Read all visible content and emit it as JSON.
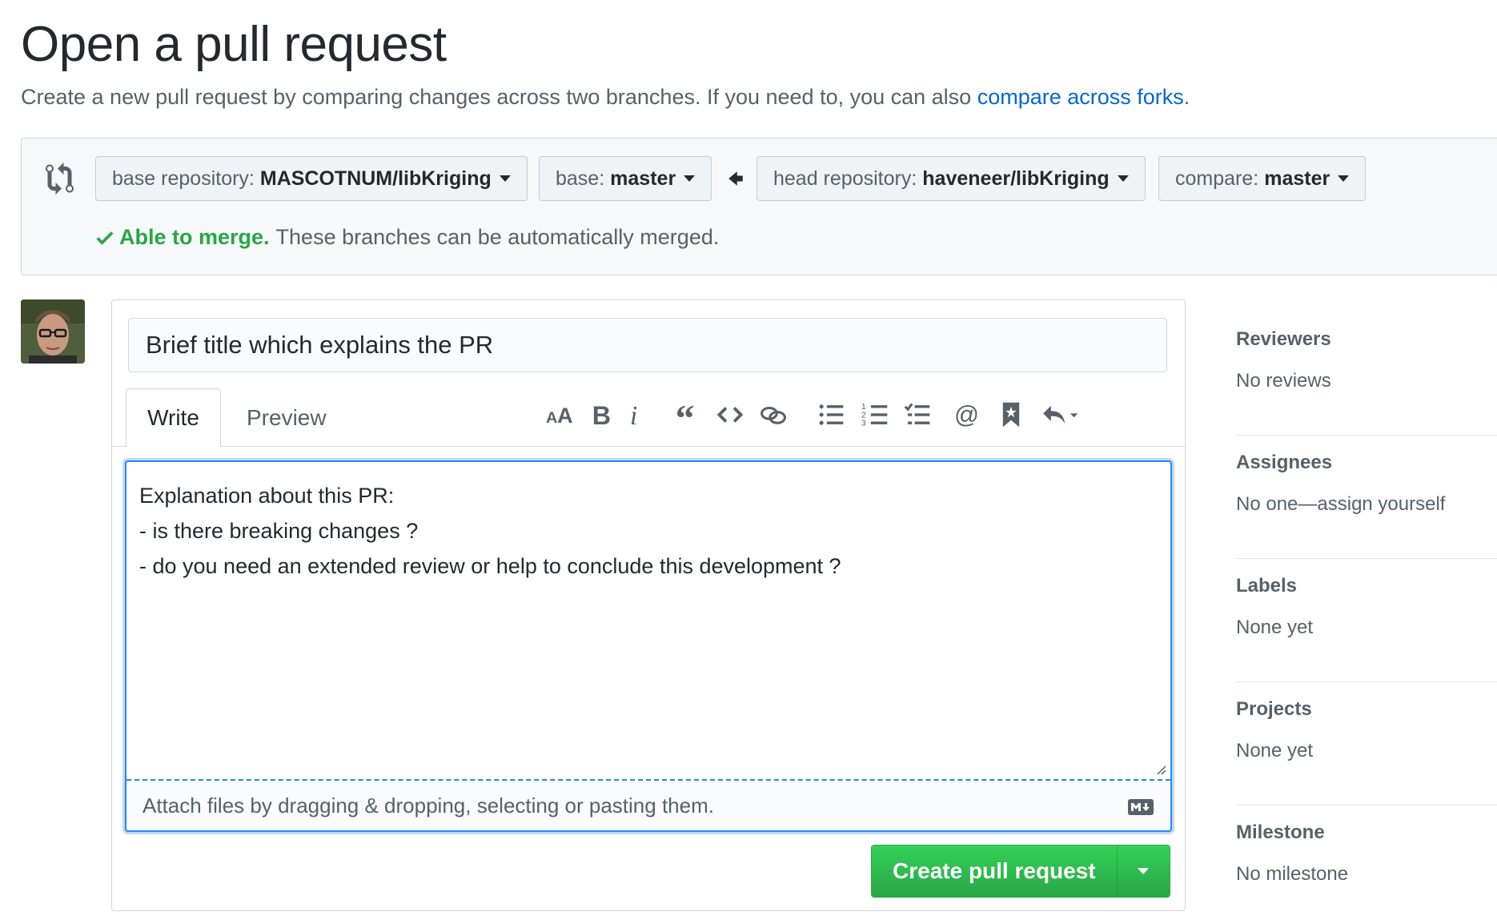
{
  "page": {
    "title": "Open a pull request",
    "subtitle_prefix": "Create a new pull request by comparing changes across two branches. If you need to, you can also ",
    "subtitle_link": "compare across forks",
    "subtitle_suffix": "."
  },
  "compare": {
    "base_repo_label": "base repository:",
    "base_repo_value": "MASCOTNUM/libKriging",
    "base_label": "base:",
    "base_value": "master",
    "head_repo_label": "head repository:",
    "head_repo_value": "haveneer/libKriging",
    "compare_label": "compare:",
    "compare_value": "master",
    "merge_ok": "Able to merge.",
    "merge_msg": "These branches can be automatically merged."
  },
  "form": {
    "title_value": "Brief title which explains the PR",
    "tabs": [
      "Write",
      "Preview"
    ],
    "body_value": "Explanation about this PR:\n- is there breaking changes ?\n- do you need an extended review or help to conclude this development ?",
    "drop_text": "Attach files by dragging & dropping, selecting or pasting them.",
    "submit_label": "Create pull request"
  },
  "toolbar_icons": [
    "header-icon",
    "bold-icon",
    "italic-icon",
    "quote-icon",
    "code-icon",
    "link-icon",
    "unordered-list-icon",
    "ordered-list-icon",
    "task-list-icon",
    "mention-icon",
    "reference-icon",
    "reply-icon"
  ],
  "sidebar": {
    "sections": [
      {
        "heading": "Reviewers",
        "value": "No reviews"
      },
      {
        "heading": "Assignees",
        "value": "No one—assign yourself"
      },
      {
        "heading": "Labels",
        "value": "None yet"
      },
      {
        "heading": "Projects",
        "value": "None yet"
      },
      {
        "heading": "Milestone",
        "value": "No milestone"
      }
    ]
  },
  "colors": {
    "accent": "#0366d6",
    "success": "#28a745",
    "focus": "#2188ff"
  }
}
